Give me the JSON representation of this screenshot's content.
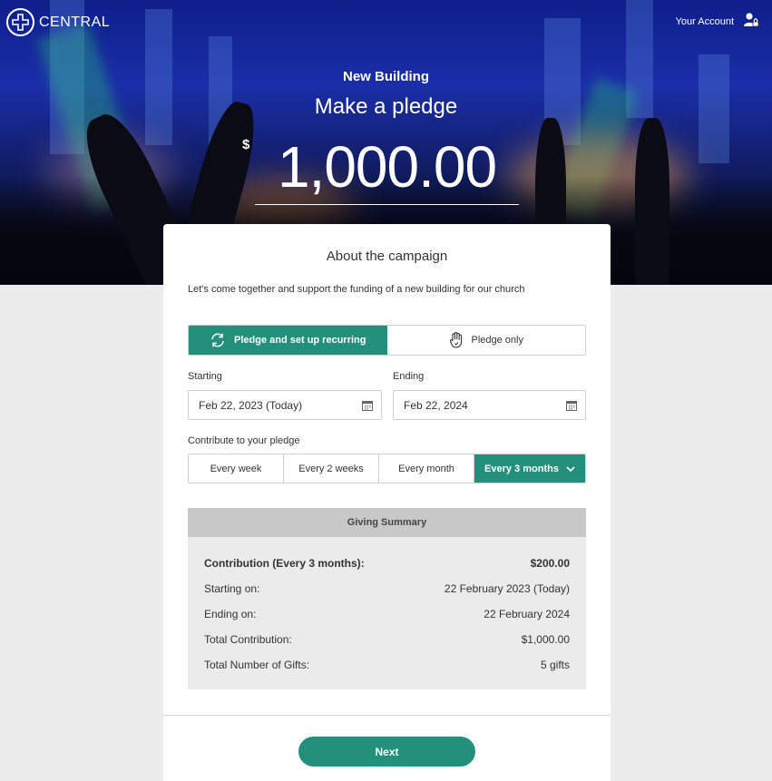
{
  "brand": {
    "name": "CENTRAL",
    "accent": "#22907a"
  },
  "account": {
    "label": "Your Account"
  },
  "hero": {
    "campaign_name": "New Building",
    "title": "Make a pledge",
    "currency_symbol": "$",
    "amount": "1,000.00"
  },
  "card": {
    "heading": "About the campaign",
    "description": "Let's come together and support the funding of a new building for our church",
    "pledge_options": [
      {
        "label": "Pledge and set up recurring",
        "icon": "recurring-icon",
        "active": true
      },
      {
        "label": "Pledge only",
        "icon": "hand-icon",
        "active": false
      }
    ],
    "starting": {
      "label": "Starting",
      "value": "Feb 22, 2023 (Today)"
    },
    "ending": {
      "label": "Ending",
      "value": "Feb 22, 2024"
    },
    "contribute_label": "Contribute to your pledge",
    "frequencies": [
      {
        "label": "Every week",
        "active": false
      },
      {
        "label": "Every 2 weeks",
        "active": false
      },
      {
        "label": "Every month",
        "active": false
      },
      {
        "label": "Every 3 months",
        "active": true
      }
    ],
    "summary": {
      "heading": "Giving Summary",
      "rows": [
        {
          "label": "Contribution (Every 3 months):",
          "value": "$200.00"
        },
        {
          "label": "Starting on:",
          "value": "22 February 2023 (Today)"
        },
        {
          "label": "Ending on:",
          "value": "22 February 2024"
        },
        {
          "label": "Total Contribution:",
          "value": "$1,000.00"
        },
        {
          "label": "Total Number of Gifts:",
          "value": "5 gifts"
        }
      ]
    },
    "next_label": "Next"
  }
}
